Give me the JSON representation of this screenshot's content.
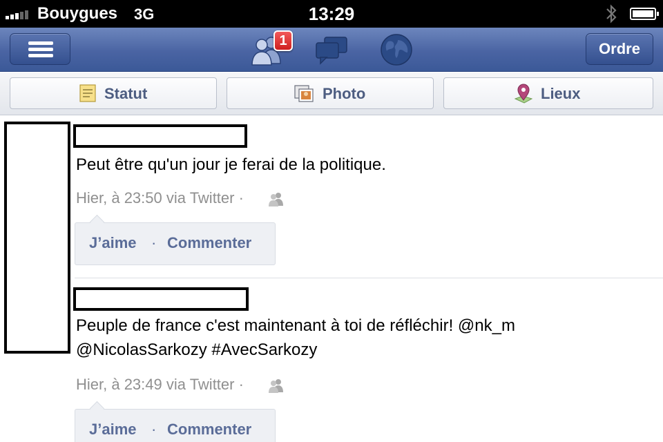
{
  "status_bar": {
    "carrier": "Bouygues",
    "network": "3G",
    "time": "13:29"
  },
  "navbar": {
    "friends_badge": "1",
    "order_label": "Ordre"
  },
  "composer": {
    "status_label": "Statut",
    "photo_label": "Photo",
    "places_label": "Lieux"
  },
  "posts": [
    {
      "text": "Peut être qu'un jour je ferai de la politique.",
      "timestamp": "Hier, à 23:50 via Twitter ·",
      "like_label": "J’aime",
      "separator": "·",
      "comment_label": "Commenter"
    },
    {
      "text_line1": "Peuple de france c'est maintenant à toi de réfléchir! @nk_m",
      "text_line2": "@NicolasSarkozy #AvecSarkozy",
      "timestamp": "Hier, à 23:49 via Twitter ·",
      "like_label": "J’aime",
      "separator": "·",
      "comment_label": "Commenter"
    }
  ],
  "colors": {
    "navbar": "#3b5998",
    "link": "#5a6c98",
    "meta": "#8f8f8f",
    "badge": "#e0302e"
  }
}
